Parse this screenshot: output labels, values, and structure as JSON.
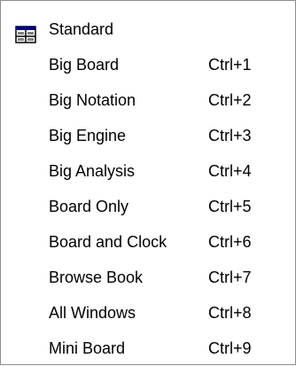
{
  "menu": {
    "items": [
      {
        "label": "Standard",
        "shortcut": "",
        "icon": "layout-window-icon"
      },
      {
        "label": "Big Board",
        "shortcut": "Ctrl+1"
      },
      {
        "label": "Big Notation",
        "shortcut": "Ctrl+2"
      },
      {
        "label": "Big Engine",
        "shortcut": "Ctrl+3"
      },
      {
        "label": "Big Analysis",
        "shortcut": "Ctrl+4"
      },
      {
        "label": "Board Only",
        "shortcut": "Ctrl+5"
      },
      {
        "label": "Board and Clock",
        "shortcut": "Ctrl+6"
      },
      {
        "label": "Browse Book",
        "shortcut": "Ctrl+7"
      },
      {
        "label": "All Windows",
        "shortcut": "Ctrl+8"
      },
      {
        "label": "Mini Board",
        "shortcut": "Ctrl+9"
      }
    ]
  },
  "colors": {
    "border": "#8e8e8e",
    "background": "#ffffff",
    "text": "#000000"
  }
}
